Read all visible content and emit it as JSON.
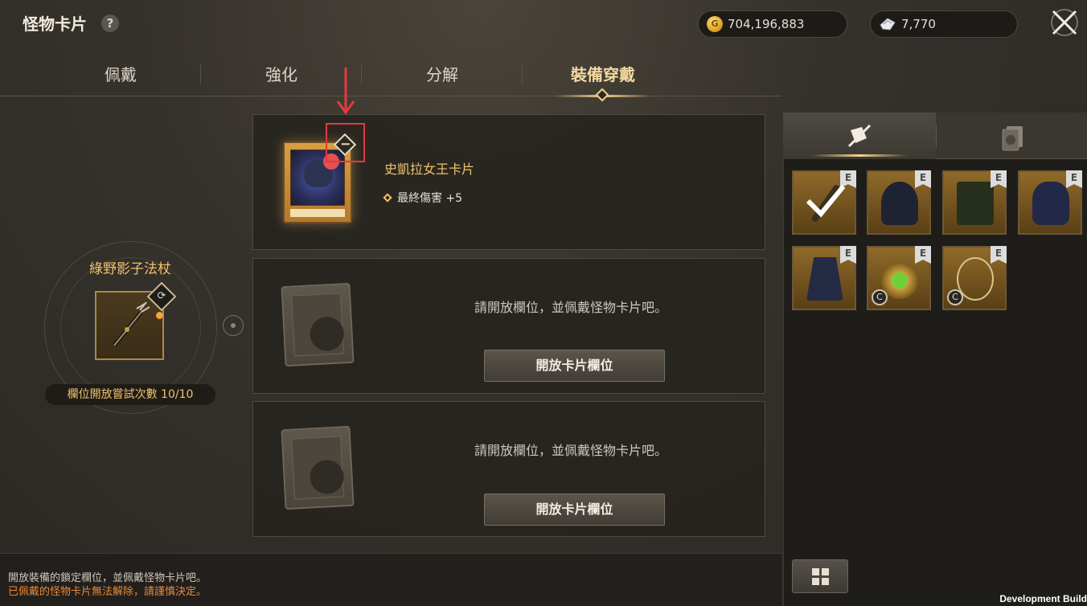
{
  "header": {
    "title": "怪物卡片",
    "help": "?"
  },
  "currency": {
    "gold": "704,196,883",
    "gem": "7,770"
  },
  "tabs": [
    {
      "label": "佩戴"
    },
    {
      "label": "強化"
    },
    {
      "label": "分解"
    },
    {
      "label": "裝備穿戴",
      "active": true
    }
  ],
  "weapon": {
    "name": "綠野影子法杖",
    "attempts": "欄位開放嘗試次數 10/10"
  },
  "slots": {
    "card": {
      "name": "史凱拉女王卡片",
      "stat": "最終傷害 +5"
    },
    "empty_message": "請開放欄位，並佩戴怪物卡片吧。",
    "open_button": "開放卡片欄位"
  },
  "footer": {
    "note": "開放裝備的鎖定欄位，並佩戴怪物卡片吧。",
    "warning": "已佩戴的怪物卡片無法解除，請謹慎決定。"
  },
  "equipment": {
    "grade_badge": "E",
    "class_badge": "C",
    "items": [
      {
        "icon": "staff-icon",
        "equipped": true
      },
      {
        "icon": "helmet-icon"
      },
      {
        "icon": "armor-icon"
      },
      {
        "icon": "gloves-icon"
      },
      {
        "icon": "cape-icon"
      },
      {
        "icon": "ring-icon",
        "class_badge": true
      },
      {
        "icon": "necklace-icon",
        "class_badge": true
      }
    ]
  },
  "colors": {
    "accent": "#f0c26a",
    "warning": "#e88a3a",
    "highlight": "#e53a3a"
  },
  "dev": {
    "label": "Development Build"
  }
}
